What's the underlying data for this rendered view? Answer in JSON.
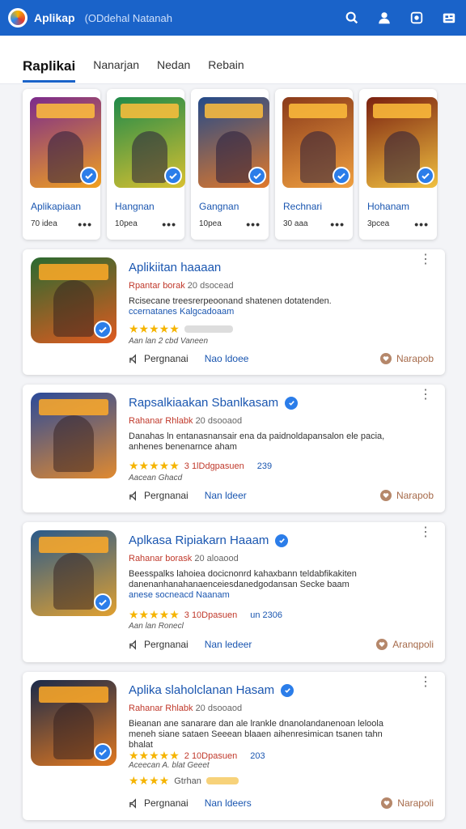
{
  "header": {
    "title": "Aplikap",
    "subtitle": "(ODdehal Natanah"
  },
  "tabs": [
    {
      "label": "Raplikai",
      "active": true
    },
    {
      "label": "Nanarjan",
      "active": false
    },
    {
      "label": "Nedan",
      "active": false
    },
    {
      "label": "Rebain",
      "active": false
    }
  ],
  "featured": [
    {
      "name": "Aplikapiaan",
      "count": "70 idea",
      "gradient": [
        "#7b2a8c",
        "#f0a020"
      ]
    },
    {
      "name": "Hangnan",
      "count": "10pea",
      "gradient": [
        "#1f8a4a",
        "#d8c030"
      ]
    },
    {
      "name": "Gangnan",
      "count": "10pea",
      "gradient": [
        "#234a8a",
        "#e0782a"
      ]
    },
    {
      "name": "Rechnari",
      "count": "30 aaa",
      "gradient": [
        "#8a3a1a",
        "#f0a040"
      ]
    },
    {
      "name": "Hohanam",
      "count": "3pcea",
      "gradient": [
        "#7a2010",
        "#f0c040"
      ]
    }
  ],
  "cards": [
    {
      "title": "Aplikiitan haaaan",
      "badge": false,
      "sub_red": "Rpantar borak",
      "sub_dim": "20 dsocead",
      "desc": "Rcisecane treesrerpeoonand shatenen dotatenden.",
      "desc_link": "ccernatanes  Kalgcadoaam",
      "rating_text": "",
      "rating_link": "",
      "by": "Aan lan 2 cbd   Vaneen",
      "share": "Pergnanai",
      "link": "Nao ldoee",
      "right": "Narapob",
      "gradient": [
        "#2a6a30",
        "#e05a20"
      ]
    },
    {
      "title": "Rapsalkiaakan Sbanlkasam",
      "badge": true,
      "sub_red": "Rahanar Rhlabk",
      "sub_dim": "20 dsooaod",
      "desc": "Danahas ln entanasnansair ena da paidnoldapansalon ele pacia,",
      "desc_link": "anhenes benenarnce aham",
      "rating_text": "3 1lDdgpasuen",
      "rating_link": "239",
      "by": "Aacean  Ghacd",
      "share": "Pergnanai",
      "link": "Nan ldeer",
      "right": "Narapob",
      "gradient": [
        "#2a4a9a",
        "#e08a30"
      ]
    },
    {
      "title": "Aplkasa Ripiakarn Haaam",
      "badge": true,
      "sub_red": "Rahanar borask",
      "sub_dim": "20 aloaood",
      "desc": "Beesspalks lahoiea docicnonrd kahaxbann teldabfikakiten danenanhanahanaenceiesdanedgodansan Secke baam",
      "desc_link": "anese socneacd  Naanam",
      "rating_text": "3 10Dpasuen",
      "rating_link": "un 2306",
      "by": "Aan lan  Ronecl",
      "share": "Pergnanai",
      "link": "Nan ledeer",
      "right": "Aranqpoli",
      "gradient": [
        "#2a5a8a",
        "#e0a030"
      ]
    },
    {
      "title": "Aplika slaholclanan Hasam",
      "badge": true,
      "sub_red": "Rahanar Rhlabk",
      "sub_dim": "20 dsooaod",
      "desc": "Bieanan ane sanarare dan ale lrankle dnanolandanenoan leloola meneh siane sataen Seeean blaaen aihenresimican tsanen tahn",
      "desc_link": "bhalat",
      "rating_text": "2 10Dpasuen",
      "rating_link": "203",
      "by": "Aceecan  A. blat  Geeet",
      "extra_rating": "Gtrhan",
      "share": "Pergnanai",
      "link": "Nan ldeers",
      "right": "Narapoli",
      "gradient": [
        "#1a2a4a",
        "#e07820"
      ]
    }
  ]
}
